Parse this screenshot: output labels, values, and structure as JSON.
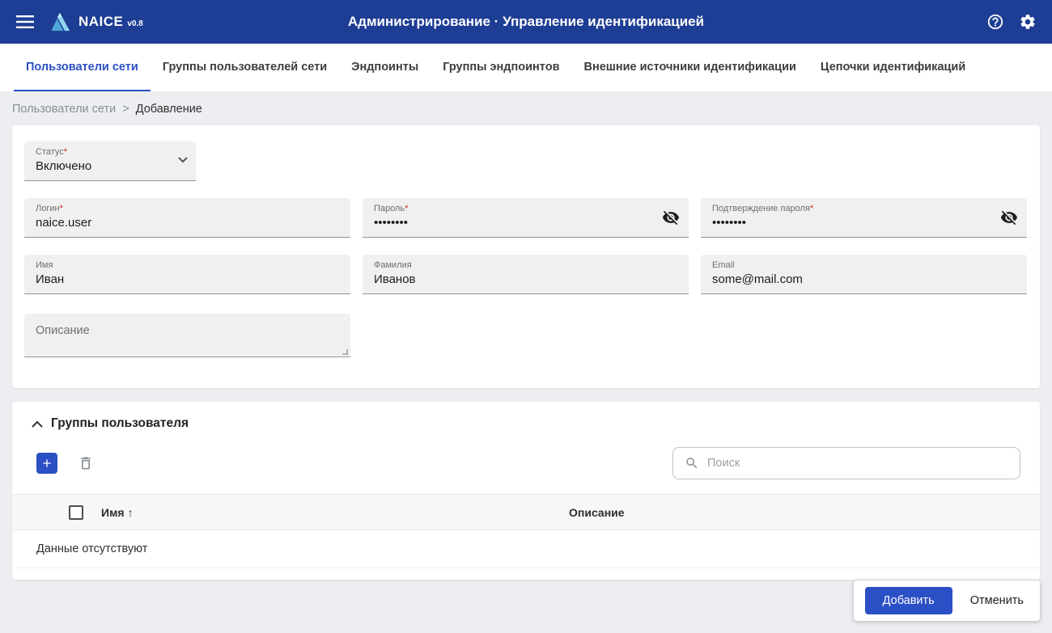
{
  "app": {
    "name": "NAICE",
    "version": "v0.8",
    "title": "Администрирование · Управление идентификацией"
  },
  "colors": {
    "topbar": "#1e3d94",
    "accent": "#2b4fc4",
    "required": "#c62828"
  },
  "icons": {
    "menu": "hamburger-icon",
    "logo": "naice-logo",
    "help": "help-circle-icon",
    "settings": "gear-icon",
    "dropdown": "chevron-down-icon",
    "password_visibility": "eye-off-icon",
    "collapse": "chevron-up-icon",
    "add": "plus-icon",
    "delete": "trash-icon",
    "search": "magnifier-icon"
  },
  "ui": {
    "required_mark": "*"
  },
  "tabs": [
    {
      "label": "Пользователи сети",
      "active": true
    },
    {
      "label": "Группы пользователей сети",
      "active": false
    },
    {
      "label": "Эндпоинты",
      "active": false
    },
    {
      "label": "Группы эндпоинтов",
      "active": false
    },
    {
      "label": "Внешние источники идентификации",
      "active": false
    },
    {
      "label": "Цепочки идентификаций",
      "active": false
    }
  ],
  "breadcrumb": {
    "parent": "Пользователи сети",
    "separator": ">",
    "current": "Добавление"
  },
  "form": {
    "status": {
      "label": "Статус",
      "value": "Включено",
      "required": true
    },
    "login": {
      "label": "Логин",
      "value": "naice.user",
      "required": true
    },
    "password": {
      "label": "Пароль",
      "value": "••••••••",
      "required": true
    },
    "password_confirm": {
      "label": "Подтверждение пароля",
      "value": "••••••••",
      "required": true
    },
    "first_name": {
      "label": "Имя",
      "value": "Иван",
      "required": false
    },
    "last_name": {
      "label": "Фамилия",
      "value": "Иванов",
      "required": false
    },
    "email": {
      "label": "Email",
      "value": "some@mail.com",
      "required": false
    },
    "description": {
      "label": "Описание",
      "value": "",
      "required": false
    }
  },
  "groups": {
    "title": "Группы пользователя",
    "search_placeholder": "Поиск",
    "table": {
      "name_label": "Имя",
      "sort_indicator": "↑",
      "description_label": "Описание",
      "empty_text": "Данные отсутствуют"
    }
  },
  "actions": {
    "submit": "Добавить",
    "cancel": "Отменить"
  }
}
